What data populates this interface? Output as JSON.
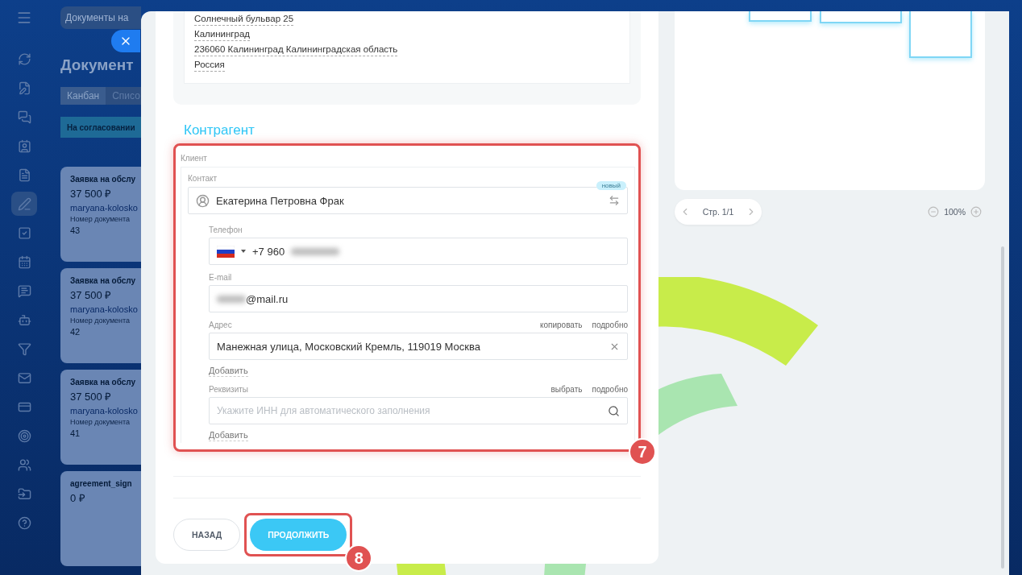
{
  "sidebar": {
    "items": [
      {
        "selected": false
      },
      {
        "selected": false
      },
      {
        "selected": false
      },
      {
        "selected": false
      },
      {
        "selected": false
      },
      {
        "selected": true
      },
      {
        "selected": false
      },
      {
        "selected": false
      },
      {
        "selected": false
      },
      {
        "selected": false
      },
      {
        "selected": false
      },
      {
        "selected": false
      },
      {
        "selected": false
      },
      {
        "selected": false
      },
      {
        "selected": false
      },
      {
        "selected": false
      },
      {
        "selected": false
      }
    ]
  },
  "background_app": {
    "search": "Документы на",
    "title": "Документ",
    "tabs": [
      {
        "label": "Канбан",
        "selected": true
      },
      {
        "label": "Списо",
        "selected": false
      }
    ],
    "column": "На согласовании",
    "cards": [
      {
        "title": "Заявка на обслу",
        "amount": "37 500 ₽",
        "user": "maryana-kolosko",
        "number_label": "Номер документа",
        "number": "43"
      },
      {
        "title": "Заявка на обслу",
        "amount": "37 500 ₽",
        "user": "maryana-kolosko",
        "number_label": "Номер документа",
        "number": "42"
      },
      {
        "title": "Заявка на обслу",
        "amount": "37 500 ₽",
        "user": "maryana-kolosko",
        "number_label": "Номер документа",
        "number": "41"
      },
      {
        "title": "agreement_sign",
        "amount": "0 ₽"
      }
    ]
  },
  "form": {
    "address_lines": [
      "Солнечный бульвар 25",
      "Калининград",
      "236060 Калининград Калининградская область",
      "Россия"
    ],
    "section_title": "Контрагент",
    "client": {
      "label": "Клиент",
      "marker": "7",
      "contact": {
        "label": "Контакт",
        "value": "Екатерина Петровна Фрак",
        "badge": "новый"
      },
      "fields": [
        {
          "kind": "phone",
          "label": "Телефон",
          "value": "+7 960",
          "redacted": true
        },
        {
          "kind": "email",
          "label": "E-mail",
          "value": "@mail.ru",
          "redacted": true
        },
        {
          "kind": "address",
          "label": "Адрес",
          "links": [
            "копировать",
            "подробно"
          ],
          "value": "Манежная улица, Московский Кремль, 119019 Москва",
          "add_link": "Добавить"
        },
        {
          "kind": "requisites",
          "label": "Реквизиты",
          "links": [
            "выбрать",
            "подробно"
          ],
          "placeholder": "Укажите ИНН для автоматического заполнения",
          "add_link": "Добавить"
        }
      ]
    },
    "buttons": [
      {
        "label": "НАЗАД",
        "kind": "secondary"
      },
      {
        "label": "ПРОДОЛЖИТЬ",
        "kind": "primary",
        "marker": "8"
      }
    ]
  },
  "preview": {
    "pager": "Стр. 1/1",
    "zoom": "100%"
  }
}
